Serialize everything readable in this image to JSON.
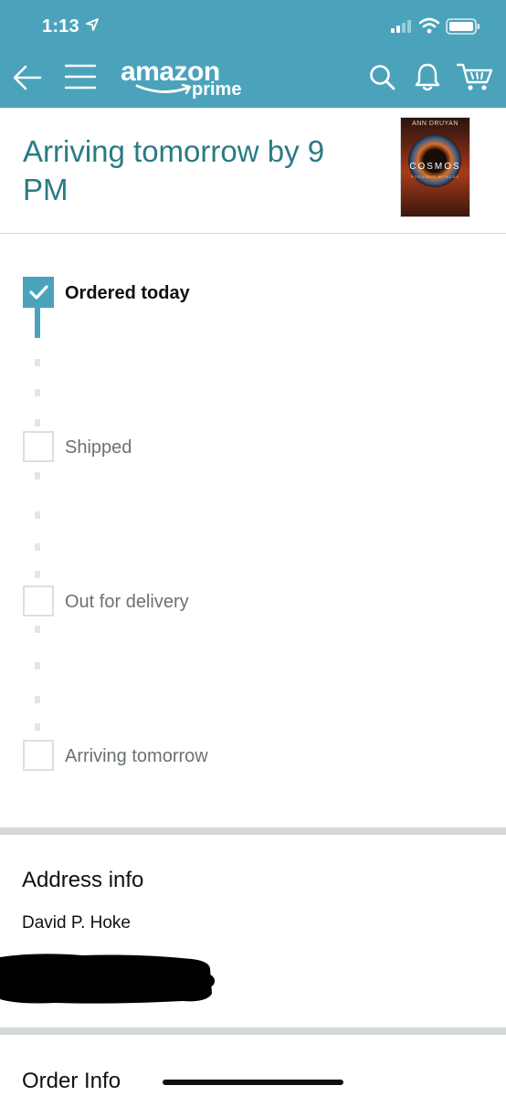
{
  "status_bar": {
    "time": "1:13"
  },
  "brand": {
    "logo_main": "amazon",
    "logo_sub": "prime",
    "color": "#4ba3bb"
  },
  "nav": {
    "icons": [
      "back-arrow-icon",
      "hamburger-menu-icon",
      "search-icon",
      "bell-icon",
      "cart-icon"
    ]
  },
  "header": {
    "arrival_text": "Arriving tomorrow by 9 PM"
  },
  "product": {
    "author": "ANN DRUYAN",
    "title": "COSMOS",
    "subtitle": "POSSIBLE WORLDS"
  },
  "tracker": {
    "steps": [
      {
        "label": "Ordered today",
        "done": true
      },
      {
        "label": "Shipped",
        "done": false
      },
      {
        "label": "Out for delivery",
        "done": false
      },
      {
        "label": "Arriving tomorrow",
        "done": false
      }
    ]
  },
  "address": {
    "title": "Address info",
    "name": "David P. Hoke"
  },
  "order_info": {
    "title": "Order Info"
  }
}
